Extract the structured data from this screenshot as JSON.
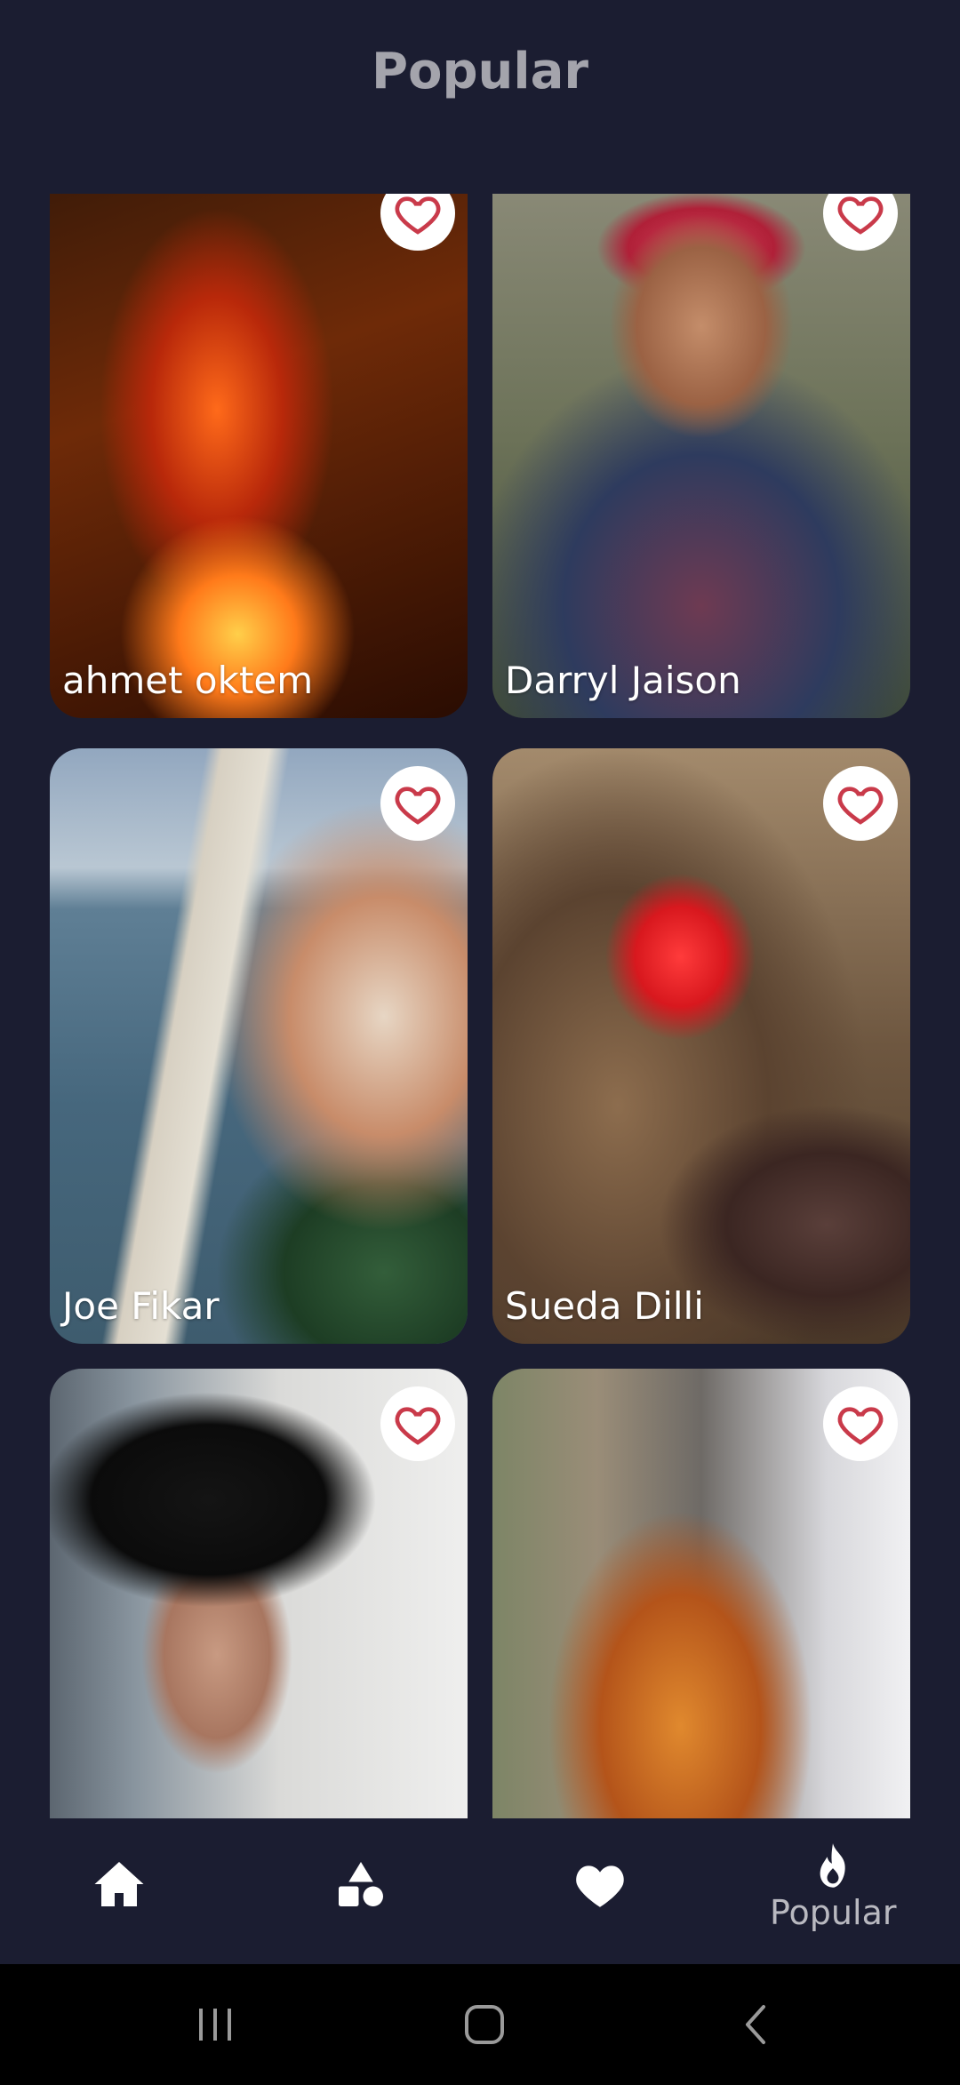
{
  "header": {
    "title": "Popular"
  },
  "cards": [
    {
      "name": "ahmet oktem",
      "photo": "fire-portrait",
      "liked": false
    },
    {
      "name": "Darryl Jaison",
      "photo": "smiling-woman-headscarf",
      "liked": false
    },
    {
      "name": "Joe Fikar",
      "photo": "coastal-town-beach",
      "liked": false
    },
    {
      "name": "Sueda Dilli",
      "photo": "rooster-lollipop",
      "liked": false
    },
    {
      "name": "",
      "photo": "woman-black-hat",
      "liked": false
    },
    {
      "name": "",
      "photo": "guitar-player",
      "liked": false
    }
  ],
  "bottom_nav": {
    "items": [
      {
        "icon": "home-icon",
        "label": ""
      },
      {
        "icon": "categories-icon",
        "label": ""
      },
      {
        "icon": "heart-icon",
        "label": ""
      },
      {
        "icon": "flame-icon",
        "label": "Popular",
        "active": true
      }
    ]
  },
  "system_nav": {
    "icons": [
      "recent-apps-icon",
      "home-button-icon",
      "back-icon"
    ]
  },
  "colors": {
    "background": "#1b1d31",
    "heart": "#c93a4a",
    "title": "#a4a4ac",
    "nav_label": "#b9b9c0"
  }
}
